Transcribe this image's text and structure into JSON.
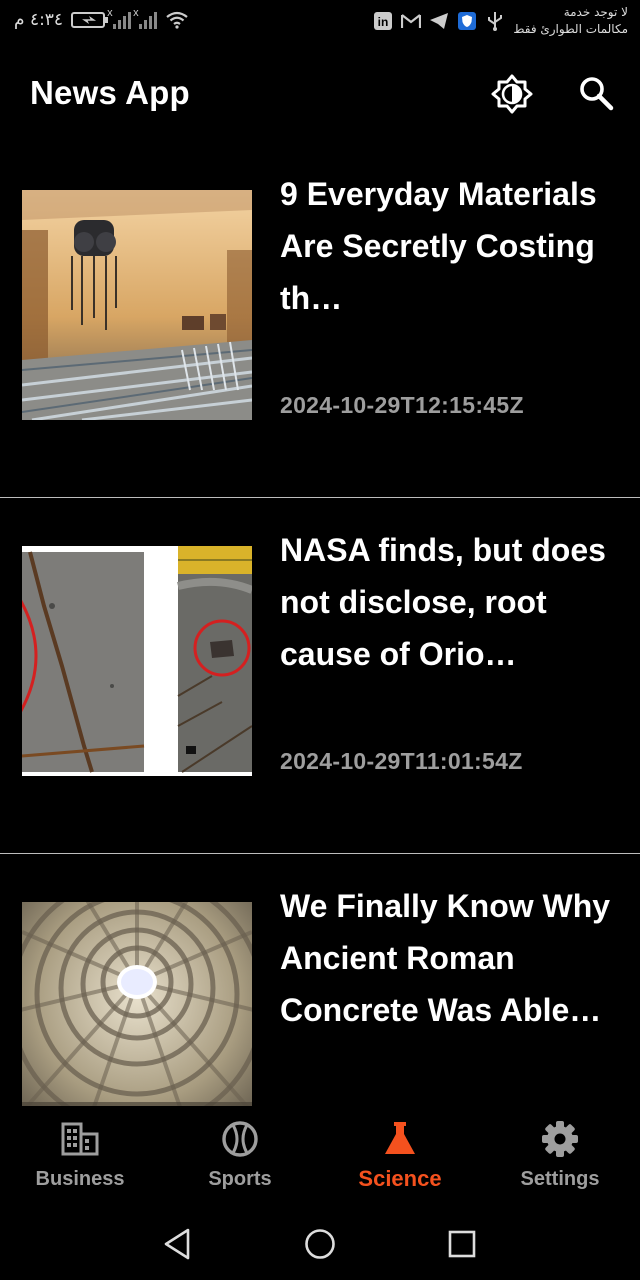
{
  "status_bar": {
    "time": "٤:٣٤ م",
    "carrier_line1": "لا توجد خدمة",
    "carrier_line2": "مكالمات الطوارئ فقط",
    "icons": [
      "battery-icon",
      "signal-icon",
      "wifi-icon",
      "linkedin-icon",
      "gmail-icon",
      "telegram-icon",
      "shield-icon",
      "usb-icon"
    ]
  },
  "app_bar": {
    "title": "News App",
    "icons": [
      "brightness-icon",
      "search-icon"
    ]
  },
  "articles": [
    {
      "title": "9 Everyday Materials Are Secretly Costing th…",
      "published": "2024-10-29T12:15:45Z",
      "image": "steel-factory-photo"
    },
    {
      "title": "NASA finds, but does not disclose, root cause of Orio…",
      "published": "2024-10-29T11:01:54Z",
      "image": "heat-shield-photo"
    },
    {
      "title": "We Finally Know Why Ancient Roman Concrete Was Able…",
      "published": "",
      "image": "pantheon-dome-photo"
    }
  ],
  "bottom_nav": {
    "items": [
      {
        "label": "Business",
        "icon": "building-icon",
        "active": false
      },
      {
        "label": "Sports",
        "icon": "ball-icon",
        "active": false
      },
      {
        "label": "Science",
        "icon": "flask-icon",
        "active": true
      },
      {
        "label": "Settings",
        "icon": "gear-icon",
        "active": false
      }
    ]
  },
  "colors": {
    "background": "#000000",
    "accent": "#f4511e",
    "muted_text": "#9e9e9e",
    "divider": "#bdbdbd"
  }
}
